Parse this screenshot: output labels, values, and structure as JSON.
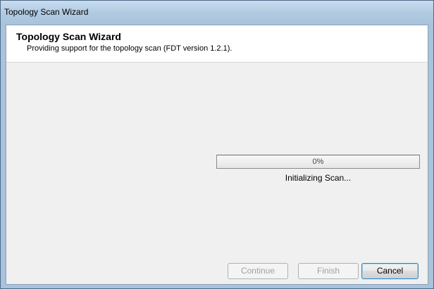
{
  "window": {
    "title": "Topology Scan Wizard"
  },
  "header": {
    "title": "Topology Scan Wizard",
    "subtitle": "Providing support for the topology scan (FDT version 1.2.1)."
  },
  "progress": {
    "value": 0,
    "label": "0%",
    "status": "Initializing Scan..."
  },
  "buttons": {
    "continue_label": "Continue",
    "finish_label": "Finish",
    "cancel_label": "Cancel"
  },
  "colors": {
    "title_bar": "#b2cbe3",
    "header_bg": "#ffffff",
    "client_bg": "#f0f0f0",
    "default_button_border": "#3c7fb1"
  }
}
